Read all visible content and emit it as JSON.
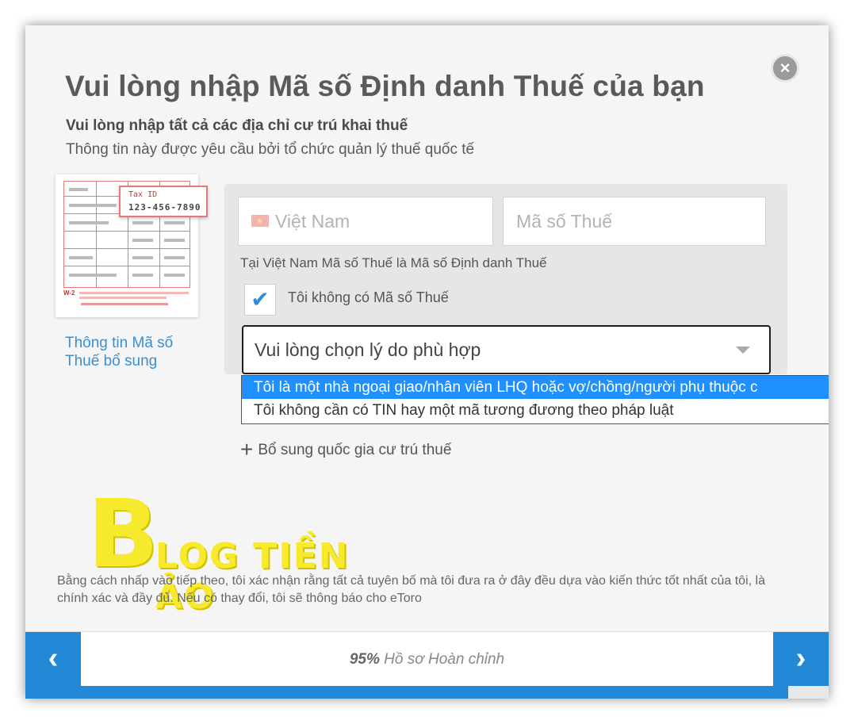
{
  "dialog": {
    "close_label": "×",
    "title": "Vui lòng nhập Mã số Định danh Thuế của bạn",
    "subtitle": "Vui lòng nhập tất cả các địa chỉ cư trú khai thuế",
    "description": "Thông tin này được yêu cầu bởi tổ chức quản lý thuế quốc tế"
  },
  "illustration": {
    "tax_id_label": "Tax ID",
    "tax_id_number": "123-456-7890",
    "form_name": "W-2"
  },
  "sidebar": {
    "more_info_link": "Thông tin Mã số Thuế bổ sung"
  },
  "form": {
    "country_value": "Việt Nam",
    "tax_number_placeholder": "Mã số Thuế",
    "note": "Tại Việt Nam Mã số Thuế là Mã số Định danh Thuế",
    "no_tin_checked": true,
    "no_tin_label": "Tôi không có Mã số Thuế",
    "reason_placeholder": "Vui lòng chọn lý do phù hợp",
    "reason_options": [
      "Tôi là một nhà ngoại giao/nhân viên LHQ hoặc vợ/chồng/người phụ thuộc c",
      "Tôi không cần có TIN hay một mã tương đương theo pháp luật"
    ],
    "selected_option_index": 0,
    "add_country_label": "Bổ sung quốc gia cư trú thuế"
  },
  "watermark": {
    "letter": "B",
    "text": "LOG TIỀN ẢO"
  },
  "disclaimer": "Bằng cách nhấp vào tiếp theo, tôi xác nhận rằng tất cả tuyên bố mà tôi đưa ra ở đây đều dựa vào kiến thức tốt nhất của tôi, là chính xác và đầy đủ. Nếu có thay đổi, tôi sẽ thông báo cho eToro",
  "footer": {
    "prev_label": "‹",
    "next_label": "›",
    "progress_percent_text": "95%",
    "progress_text": "Hồ sơ Hoàn chỉnh",
    "progress_fraction": 0.95
  },
  "colors": {
    "accent": "#2389d6",
    "selected_option": "#1e90ff",
    "form_red": "#e27a7a",
    "watermark_yellow": "#f7ea2c"
  },
  "icons": {
    "close": "close-icon",
    "check": "checkmark-icon",
    "dropdown": "chevron-down-icon",
    "add": "plus-icon",
    "prev": "chevron-left-icon",
    "next": "chevron-right-icon",
    "flag": "vietnam-flag-icon"
  }
}
